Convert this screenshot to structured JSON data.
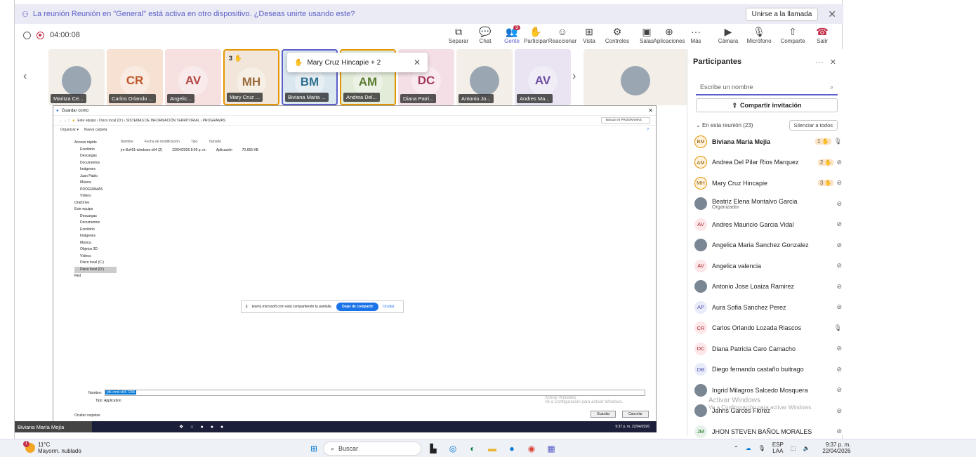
{
  "banner": {
    "message": "La reunión Reunión en \"General\" está activa en otro dispositivo. ¿Deseas unirte usando este?",
    "join_label": "Unirse a la llamada"
  },
  "meeting": {
    "timer": "04:00:08"
  },
  "toolbar": {
    "items": [
      {
        "label": "Separar",
        "icon": "⧉"
      },
      {
        "label": "Chat",
        "icon": "💬"
      },
      {
        "label": "Gente",
        "icon": "👥",
        "badge": "9"
      },
      {
        "label": "Participar",
        "icon": "✋"
      },
      {
        "label": "Reaccionar",
        "icon": "☺"
      },
      {
        "label": "Vista",
        "icon": "⊞"
      },
      {
        "label": "Controles",
        "icon": "⚙"
      },
      {
        "label": "Salas",
        "icon": "▣"
      },
      {
        "label": "Aplicaciones",
        "icon": "⊕"
      },
      {
        "label": "Más",
        "icon": "···"
      },
      {
        "label": "Cámara",
        "icon": "▶"
      },
      {
        "label": "Micrófono",
        "icon": "🎙"
      },
      {
        "label": "Comparte",
        "icon": "⇧"
      },
      {
        "label": "Salir",
        "icon": "☎"
      }
    ]
  },
  "tiles": [
    {
      "initials": "",
      "name": "Maritza Ce...",
      "bg": "#f3eee8"
    },
    {
      "initials": "CR",
      "name": "Carlos Orlando ...",
      "bg": "#f6e1d3",
      "color": "#c0552a"
    },
    {
      "initials": "AV",
      "name": "Angelic...",
      "bg": "#f6e0e0",
      "color": "#b44646"
    },
    {
      "initials": "MH",
      "name": "Mary Cruz ...",
      "bg": "#f1e6d9",
      "color": "#9b6a3b",
      "hand": "3"
    },
    {
      "initials": "BM",
      "name": "Biviana Maria ...",
      "bg": "#dbe7ef",
      "color": "#2e6f91",
      "hand": "1"
    },
    {
      "initials": "AM",
      "name": "Andrea Del...",
      "bg": "#e3ecd9",
      "color": "#5a7a2f"
    },
    {
      "initials": "DC",
      "name": "Diana Patri...",
      "bg": "#f4dfe6",
      "color": "#a3395b"
    },
    {
      "initials": "",
      "name": "Antonio Jo...",
      "bg": "#f3eee8"
    },
    {
      "initials": "AV",
      "name": "Andres Ma...",
      "bg": "#e9e3f2",
      "color": "#6b4ba1"
    },
    {
      "initials": "",
      "name": "",
      "bg": "#f3eee8"
    }
  ],
  "popup": {
    "label": "Mary Cruz Hincapie + 2"
  },
  "dialog": {
    "title": "Guardar como",
    "path": "Este equipo  ›  Disco local (D:)  ›  SISTEMAS DE INFORMACIÓN TERRITORIAL  ›  PROGRAMAS",
    "search_placeholder": "Buscar en PROGRAMAS",
    "cmd_organize": "Organizar ▾",
    "cmd_new_folder": "Nueva carpeta",
    "columns": [
      "Nombre",
      "Fecha de modificación",
      "Tipo",
      "Tamaño"
    ],
    "file": {
      "name": "jre-8u491-windows-x64 (2)",
      "date": "22/04/2026 8:09 p. m.",
      "type": "Aplicación",
      "size": "70.655 KB"
    },
    "nav": [
      "Acceso rápido",
      "Escritorio",
      "Descargas",
      "Documentos",
      "Imágenes",
      "Juan Pablo",
      "Música",
      "PROGRAMAS",
      "Vídeos",
      "OneDrive",
      "Este equipo",
      "Descargas",
      "Documentos",
      "Escritorio",
      "Imágenes",
      "Música",
      "Objetos 3D",
      "Vídeos",
      "Disco local (C:)",
      "Disco local (D:)",
      "Red"
    ],
    "filename_label": "Nombre:",
    "filename_value": "jdk-cmd-x64-7206",
    "type_label": "Tipo:",
    "type_value": "Application",
    "hide_folders": "Ocultar carpetas",
    "save_label": "Guardar",
    "cancel_label": "Cancelar",
    "watermark_title": "Activar Windows",
    "watermark_sub": "Ve a Configuración para activar Windows."
  },
  "sharebar": {
    "message": "teams.microsoft.com está compartiendo tu pantalla.",
    "stop_label": "Dejar de compartir",
    "hide_label": "Ocultar"
  },
  "inner_taskbar": {
    "clock": "9:37 p. m. 22/04/2026"
  },
  "selfview": {
    "name": "Biviana María Mejía"
  },
  "panel": {
    "title": "Participantes",
    "search_placeholder": "Escribe un nombre",
    "invite_label": "Compartir invitación",
    "in_meeting": "En esta reunión (23)",
    "mute_all": "Silenciar a todos",
    "participants": [
      {
        "initials": "BM",
        "name": "Biviana Maria Mejia",
        "bold": true,
        "hand": "1",
        "mic": "on",
        "ring": true
      },
      {
        "initials": "AM",
        "name": "Andrea Del Pilar Rios Marquez",
        "hand": "2",
        "mic": "off",
        "ring": true
      },
      {
        "initials": "MH",
        "name": "Mary Cruz Hincapie",
        "hand": "3",
        "mic": "off",
        "ring": true
      },
      {
        "initials": "",
        "name": "Beatriz Elena Montalvo Garcia",
        "role": "Organizador",
        "mic": "off",
        "photo": true
      },
      {
        "initials": "AV",
        "name": "Andres Mauricio Garcia Vidal",
        "mic": "off"
      },
      {
        "initials": "",
        "name": "Angelica Maria Sanchez Gonzalez",
        "mic": "off",
        "photo": true
      },
      {
        "initials": "AV",
        "name": "Angelica valencia",
        "mic": "off"
      },
      {
        "initials": "",
        "name": "Antonio Jose Loaiza Ramirez",
        "mic": "off",
        "photo": true
      },
      {
        "initials": "AP",
        "name": "Aura Sofia Sanchez Perez",
        "mic": "off"
      },
      {
        "initials": "CR",
        "name": "Carlos Orlando Lozada Riascos",
        "mic": "on"
      },
      {
        "initials": "DC",
        "name": "Diana Patricia Caro Camacho",
        "mic": "off"
      },
      {
        "initials": "DB",
        "name": "Diego fernando castaño buitrago",
        "mic": "off"
      },
      {
        "initials": "",
        "name": "Ingrid Milagros Salcedo Mosquera",
        "mic": "off",
        "photo": true
      },
      {
        "initials": "",
        "name": "Jahns Garces Florez",
        "mic": "off",
        "photo": true
      },
      {
        "initials": "JM",
        "name": "JHON STEVEN BAÑOL MORALES",
        "mic": "off"
      }
    ],
    "watermark_title": "Activar Windows",
    "watermark_sub": "Ve a Configuración para activar Windows."
  },
  "taskbar": {
    "temp": "11°C",
    "weather": "Mayorm. nublado",
    "search": "Buscar",
    "lang1": "ESP",
    "lang2": "LAA",
    "time": "9:37 p. m.",
    "date": "22/04/2026"
  }
}
